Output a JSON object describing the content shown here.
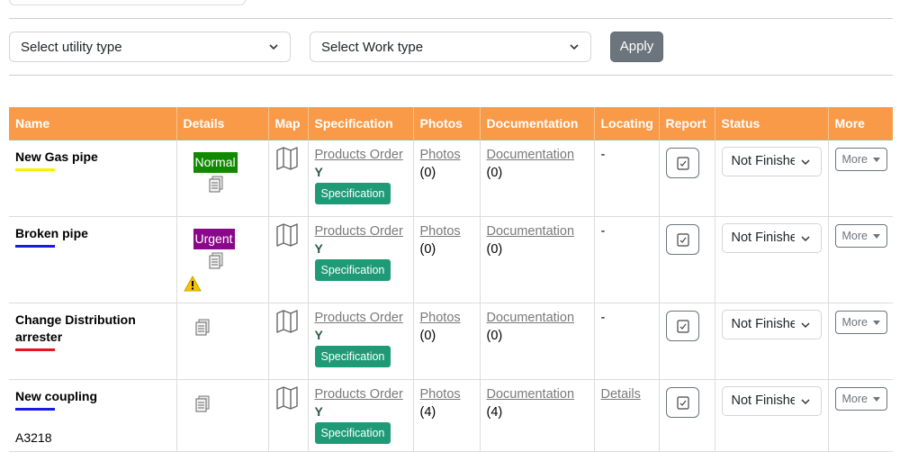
{
  "filters": {
    "utility_type_placeholder": "Select utility type",
    "work_type_placeholder": "Select Work type",
    "apply_label": "Apply"
  },
  "table": {
    "headers": [
      "Name",
      "Details",
      "Map",
      "Specification",
      "Photos",
      "Documentation",
      "Locating",
      "Report",
      "Status",
      "More"
    ],
    "rows": [
      {
        "name_lines": [
          "New Gas pipe"
        ],
        "underline_color": "#f5f300",
        "code": "",
        "badge": "Normal",
        "badge_color": "#118a00",
        "warning": false,
        "products_order": "Products Order",
        "spec_flag": "Y",
        "spec_button": "Specification",
        "photos_label": "Photos",
        "photos_count": "(0)",
        "docs_label": "Documentation",
        "docs_count": "(0)",
        "locating": "-",
        "status": "Not Finished",
        "more": "More"
      },
      {
        "name_lines": [
          "Broken pipe"
        ],
        "underline_color": "#1a1ae6",
        "code": "",
        "badge": "Urgent",
        "badge_color": "#8a078a",
        "warning": true,
        "products_order": "Products Order",
        "spec_flag": "Y",
        "spec_button": "Specification",
        "photos_label": "Photos",
        "photos_count": "(0)",
        "docs_label": "Documentation",
        "docs_count": "(0)",
        "locating": "-",
        "status": "Not Finished",
        "more": "More"
      },
      {
        "name_lines": [
          "Change Distribution",
          "arrester"
        ],
        "underline_color": "#e6151c",
        "code": "",
        "badge": "",
        "badge_color": "",
        "warning": false,
        "products_order": "Products Order",
        "spec_flag": "Y",
        "spec_button": "Specification",
        "photos_label": "Photos",
        "photos_count": "(0)",
        "docs_label": "Documentation",
        "docs_count": "(0)",
        "locating": "-",
        "status": "Not Finished",
        "more": "More"
      },
      {
        "name_lines": [
          "New coupling"
        ],
        "underline_color": "#1a1ae6",
        "code": "A3218",
        "badge": "",
        "badge_color": "",
        "warning": false,
        "products_order": "Products Order",
        "spec_flag": "Y",
        "spec_button": "Specification",
        "photos_label": "Photos",
        "photos_count": "(4)",
        "docs_label": "Documentation",
        "docs_count": "(4)",
        "locating": "Details",
        "status": "Not Finished",
        "more": "More"
      }
    ]
  },
  "icons": {
    "document": "document-icon",
    "warning": "warning-icon",
    "map": "map-icon",
    "report": "report-icon",
    "chevron": "chevron-down-icon"
  },
  "colors": {
    "header_bg": "#f99a49",
    "spec_button": "#1f9a77",
    "apply_button": "#6c757d"
  }
}
